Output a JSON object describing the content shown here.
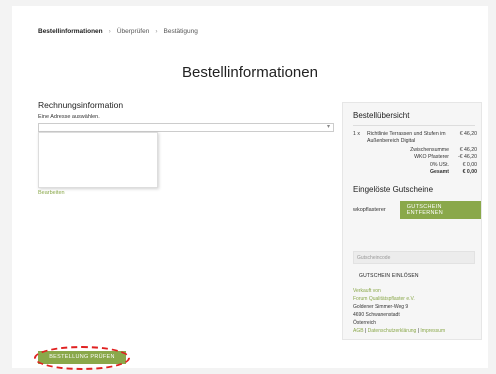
{
  "breadcrumb": {
    "step1": "Bestellinformationen",
    "separator": "›",
    "step2": "Überprüfen",
    "step3": "Bestätigung"
  },
  "page_title": "Bestellinformationen",
  "billing": {
    "heading": "Rechnungsinformation",
    "select_prompt": "Eine Adresse auswählen.",
    "edit_link": "Bearbeiten"
  },
  "summary": {
    "heading": "Bestellübersicht",
    "item": {
      "qty": "1 x",
      "name": "Richtlinie Terrassen und Stufen im Außenbereich Digital",
      "price": "€ 46,20"
    },
    "totals": [
      {
        "label": "Zwischensumme",
        "value": "€ 46,20",
        "bold": false
      },
      {
        "label": "WKO Pfasterer",
        "value": "-€ 46,20",
        "bold": false
      },
      {
        "label": "0% USt.",
        "value": "€ 0,00",
        "bold": false
      },
      {
        "label": "Gesamt",
        "value": "€ 0,00",
        "bold": true
      }
    ],
    "coupons_heading": "Eingelöste Gutscheine",
    "applied_coupon": "wkopflasterer",
    "remove_coupon_button": "GUTSCHEIN ENTFERNEN",
    "coupon_input_placeholder": "Gutscheincode",
    "redeem_button": "GUTSCHEIN EINLÖSEN",
    "sold_by_label": "Verkauft von",
    "seller_name": "Forum Qualitätspflaster e.V.",
    "seller_address": [
      "Goldener Simmer-Weg 9",
      "4690 Schwanenstadt",
      "Österreich"
    ],
    "footer_links": {
      "agb": "AGB",
      "sep": "|",
      "privacy": "Datenschutzerklärung",
      "imprint": "Impressum"
    }
  },
  "actions": {
    "check_order_button": "BESTELLUNG PRÜFEN"
  },
  "colors": {
    "accent": "#8aa84a",
    "highlight": "#e02020"
  }
}
